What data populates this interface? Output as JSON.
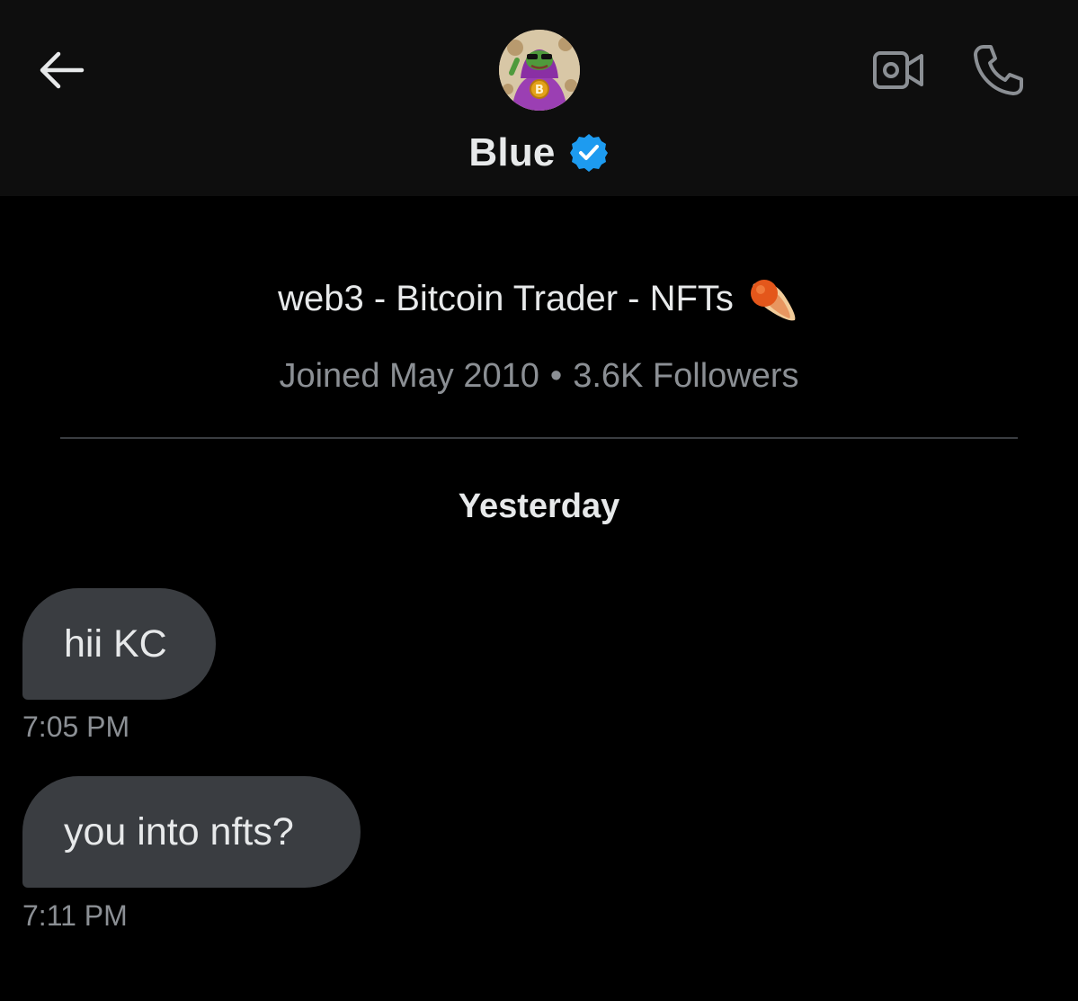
{
  "header": {
    "name": "Blue",
    "icons": {
      "back": "arrow-left-icon",
      "verified": "verified-badge-icon",
      "video": "video-call-icon",
      "call": "phone-icon"
    },
    "verified_color": "#1d9bf0"
  },
  "profile": {
    "bio": "web3 - Bitcoin Trader - NFTs",
    "bio_emoji": "comet-emoji",
    "joined": "Joined May 2010",
    "separator": "•",
    "followers": "3.6K Followers"
  },
  "conversation": {
    "day_label": "Yesterday",
    "messages": [
      {
        "text": "hii KC",
        "time": "7:05 PM"
      },
      {
        "text": "you into nfts?",
        "time": "7:11 PM"
      }
    ]
  },
  "colors": {
    "background": "#000000",
    "header_bg": "#0e0e0e",
    "bubble_bg": "#3a3d41",
    "secondary_text": "#8b8f94"
  }
}
